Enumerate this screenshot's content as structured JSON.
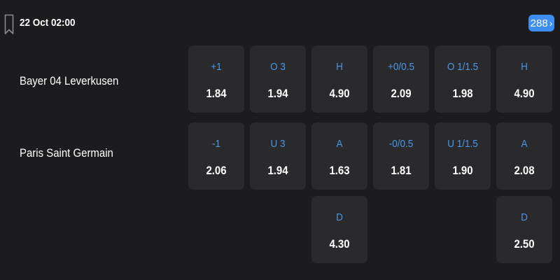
{
  "header": {
    "match_time": "22 Oct 02:00",
    "more_markets_count": "288",
    "more_icon": "chevron-right-icon",
    "bookmark_icon": "bookmark-icon"
  },
  "teams": {
    "home": "Bayer 04 Leverkusen",
    "away": "Paris Saint Germain"
  },
  "odds": {
    "home_row": [
      {
        "label": "+1",
        "value": "1.84"
      },
      {
        "label": "O 3",
        "value": "1.94"
      },
      {
        "label": "H",
        "value": "4.90"
      },
      {
        "label": "+0/0.5",
        "value": "2.09"
      },
      {
        "label": "O 1/1.5",
        "value": "1.98"
      },
      {
        "label": "H",
        "value": "4.90"
      }
    ],
    "away_row": [
      {
        "label": "-1",
        "value": "2.06"
      },
      {
        "label": "U 3",
        "value": "1.94"
      },
      {
        "label": "A",
        "value": "1.63"
      },
      {
        "label": "-0/0.5",
        "value": "1.81"
      },
      {
        "label": "U 1/1.5",
        "value": "1.90"
      },
      {
        "label": "A",
        "value": "2.08"
      }
    ],
    "draw_row": [
      {
        "label": "D",
        "value": "4.30"
      },
      {
        "label": "D",
        "value": "2.50"
      }
    ]
  },
  "colors": {
    "background": "#1c1c1e",
    "cell": "#2a2a2d",
    "label_accent": "#4a97e8",
    "badge": "#3d8ef0"
  }
}
